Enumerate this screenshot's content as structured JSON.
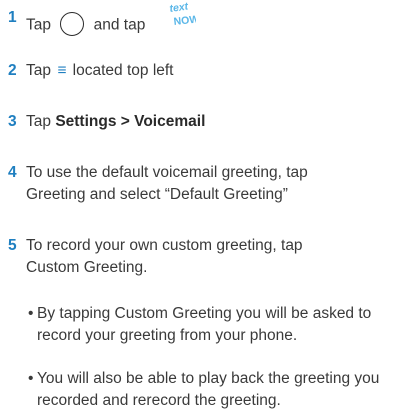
{
  "steps": [
    {
      "number": "1",
      "text_a": "Tap",
      "text_b": "and tap",
      "app_icon_name": "textnow-app-icon",
      "app_icon_text_top": "text",
      "app_icon_text_bottom": "NOW"
    },
    {
      "number": "2",
      "text_a": "Tap",
      "icon_glyph": "≡",
      "icon_name": "hamburger-menu-icon",
      "text_b": "located top left"
    },
    {
      "number": "3",
      "text_a": "Tap",
      "bold_a": "Settings",
      "separator": ">",
      "bold_b": "Voicemail"
    },
    {
      "number": "4",
      "text": "To use the default voicemail greeting, tap Greeting and select “Default Greeting”"
    },
    {
      "number": "5",
      "text": "To record your own custom greeting, tap Custom Greeting."
    }
  ],
  "bullets": [
    {
      "dot": "•",
      "text": "By tapping Custom Greeting you will be asked to record your greeting from your phone."
    },
    {
      "dot": "•",
      "text": "You will also be able to play back the greeting you recorded and rerecord the greeting."
    }
  ],
  "colors": {
    "accent": "#1f7fc0",
    "text": "#3a3a3a",
    "app_icon_text": "#5bb7e8"
  }
}
